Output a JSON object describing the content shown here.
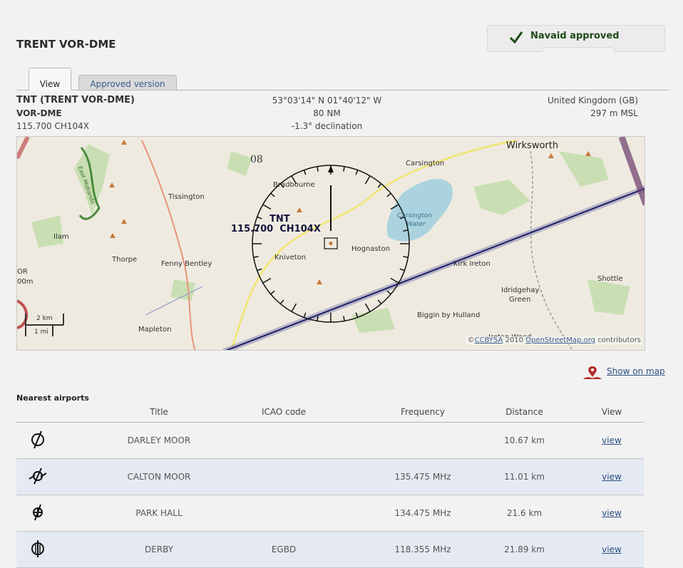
{
  "banner": {
    "text": "Navaid approved",
    "color": "#1e4a16"
  },
  "page_title": "TRENT VOR-DME",
  "tabs": [
    {
      "label": "View",
      "active": true
    },
    {
      "label": "Approved version",
      "active": false
    }
  ],
  "navaid": {
    "ident_name": "TNT (TRENT VOR-DME)",
    "type": "VOR-DME",
    "frequency": "115.700 CH104X",
    "coordinates": "53°03'14\" N 01°40'12\" W",
    "range": "80 NM",
    "declination": "-1.3° declination",
    "country": "United Kingdom (GB)",
    "elevation": "297 m MSL"
  },
  "map": {
    "compass_label": "08",
    "navaid_ident": "TNT",
    "navaid_freq": "115.700  CH104X",
    "places": [
      "Wirksworth",
      "Carsington",
      "Bradbourne",
      "Tissington",
      "Ilam",
      "Thorpe",
      "Fenny Bentley",
      "Kniveton",
      "Hognaston",
      "Kirk Ireton",
      "Idridgehay",
      "Green",
      "Shottle",
      "Biggin by Hulland",
      "Mapleton",
      "Ireton Wood",
      "Carsington",
      "Water",
      "East Midlands"
    ],
    "scale_km": "2 km",
    "scale_mi": "1 mi",
    "edge_text_1": "OR",
    "edge_text_2": "00m",
    "attribution": {
      "prefix": "©",
      "license": "CCBYSA",
      "year": "2010",
      "osm": "OpenStreetMap.org",
      "suffix": "contributors"
    }
  },
  "show_on_map": "Show on map",
  "nearest": {
    "title": "Nearest airports",
    "columns": [
      "Title",
      "ICAO code",
      "Frequency",
      "Distance",
      "View"
    ],
    "rows": [
      {
        "icon": "airfield-icon",
        "title": "DARLEY MOOR",
        "icao": "",
        "frequency": "",
        "distance": "10.67 km",
        "view": "view"
      },
      {
        "icon": "glider-site-icon",
        "title": "CALTON MOOR",
        "icao": "",
        "frequency": "135.475 MHz",
        "distance": "11.01 km",
        "view": "view"
      },
      {
        "icon": "heliport-icon",
        "title": "PARK HALL",
        "icao": "",
        "frequency": "134.475 MHz",
        "distance": "21.6 km",
        "view": "view"
      },
      {
        "icon": "airport-icon",
        "title": "DERBY",
        "icao": "EGBD",
        "frequency": "118.355 MHz",
        "distance": "21.89 km",
        "view": "view"
      }
    ]
  }
}
